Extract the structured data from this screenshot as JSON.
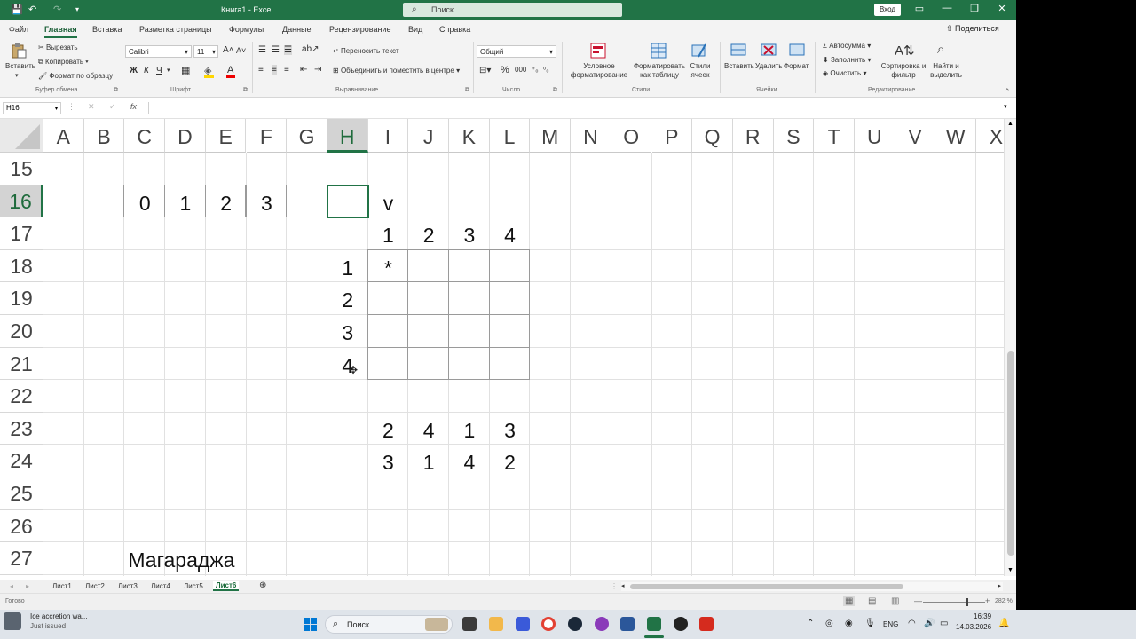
{
  "titlebar": {
    "title": "Книга1  -  Excel",
    "search_placeholder": "Поиск",
    "login": "Вход"
  },
  "ribbon_tabs": [
    "Файл",
    "Главная",
    "Вставка",
    "Разметка страницы",
    "Формулы",
    "Данные",
    "Рецензирование",
    "Вид",
    "Справка"
  ],
  "share_label": "Поделиться",
  "ribbon": {
    "clipboard": {
      "paste": "Вставить",
      "cut": "Вырезать",
      "copy": "Копировать",
      "format_painter": "Формат по образцу",
      "group": "Буфер обмена"
    },
    "font": {
      "name": "Calibri",
      "size": "11",
      "bold": "Ж",
      "italic": "К",
      "underline": "Ч",
      "group": "Шрифт"
    },
    "alignment": {
      "wrap": "Переносить текст",
      "merge": "Объединить и поместить в центре",
      "group": "Выравнивание"
    },
    "number": {
      "format": "Общий",
      "group": "Число"
    },
    "styles": {
      "conditional": "Условное форматирование",
      "as_table": "Форматировать как таблицу",
      "cell_styles": "Стили ячеек",
      "group": "Стили"
    },
    "cells": {
      "insert": "Вставить",
      "delete": "Удалить",
      "format": "Формат",
      "group": "Ячейки"
    },
    "editing": {
      "autosum": "Автосумма",
      "fill": "Заполнить",
      "clear": "Очистить",
      "sort": "Сортировка и фильтр",
      "find": "Найти и выделить",
      "group": "Редактирование"
    }
  },
  "formula_bar": {
    "name_box": "H16",
    "fx": "fx",
    "cancel": "✕",
    "enter": "✓"
  },
  "columns": [
    "A",
    "B",
    "C",
    "D",
    "E",
    "F",
    "G",
    "H",
    "I",
    "J",
    "K",
    "L",
    "M",
    "N",
    "O",
    "P",
    "Q",
    "R",
    "S",
    "T",
    "U",
    "V",
    "W",
    "X"
  ],
  "rows": [
    "15",
    "16",
    "17",
    "18",
    "19",
    "20",
    "21",
    "22",
    "23",
    "24",
    "25",
    "26",
    "27"
  ],
  "cells": {
    "C16": "0",
    "D16": "1",
    "E16": "2",
    "F16": "3",
    "I16": "v",
    "I17": "1",
    "J17": "2",
    "K17": "3",
    "L17": "4",
    "H18": "1",
    "I18": "*",
    "H19": "2",
    "H20": "3",
    "H21": "4",
    "I23": "2",
    "J23": "4",
    "K23": "1",
    "L23": "3",
    "I24": "3",
    "J24": "1",
    "K24": "4",
    "L24": "2",
    "C27": "Магараджа"
  },
  "sheets": [
    "Лист1",
    "Лист2",
    "Лист3",
    "Лист4",
    "Лист5",
    "Лист6"
  ],
  "active_sheet": "Лист6",
  "status": {
    "ready": "Готово",
    "zoom": "282 %"
  },
  "taskbar": {
    "notification_title": "Ice accretion wa...",
    "notification_sub": "Just issued",
    "search": "Поиск",
    "lang": "ENG",
    "time": "16:39",
    "date": "14.03.2026"
  },
  "colors": {
    "excel_green": "#217346"
  }
}
